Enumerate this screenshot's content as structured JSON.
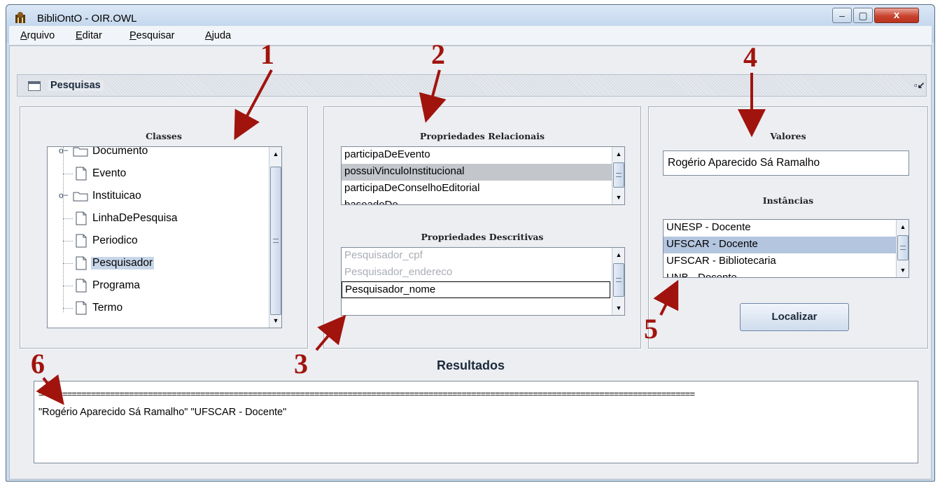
{
  "window": {
    "title": "BibliOntO - OIR.OWL",
    "controls": {
      "minimize": "‒",
      "maximize": "▢",
      "close": "x"
    }
  },
  "menu": [
    "Arquivo",
    "Editar",
    "Pesquisar",
    "Ajuda"
  ],
  "internal_frame": {
    "title": "Pesquisas"
  },
  "classes_panel": {
    "title": "Classes",
    "items": [
      "Documento",
      "Evento",
      "Instituicao",
      "LinhaDePesquisa",
      "Periodico",
      "Pesquisador",
      "Programa",
      "Termo"
    ],
    "selected": "Pesquisador"
  },
  "relational_panel": {
    "title": "Propriedades Relacionais",
    "items": [
      "participaDeEvento",
      "possuiVinculoInstitucional",
      "participaDeConselhoEditorial",
      "baseadoDe"
    ],
    "selected": "possuiVinculoInstitucional"
  },
  "descriptive_panel": {
    "title": "Propriedades Descritivas",
    "items": [
      "Pesquisador_cpf",
      "Pesquisador_endereco",
      "Pesquisador_nome",
      ""
    ],
    "selected": "Pesquisador_nome"
  },
  "values_panel": {
    "title": "Valores",
    "value": "Rogério Aparecido Sá Ramalho",
    "instances_title": "Instâncias",
    "instances": [
      "UNESP - Docente",
      "UFSCAR - Docente",
      "UFSCAR - Bibliotecaria",
      "UNB - Docente"
    ],
    "selected_instance": "UFSCAR - Docente",
    "locate_button": "Localizar"
  },
  "results": {
    "title": "Resultados",
    "separator": "==========================================================================================================================================",
    "line": "\"Rogério Aparecido Sá Ramalho\"  \"UFSCAR - Docente\""
  },
  "annotations": [
    "1",
    "2",
    "3",
    "4",
    "5",
    "6"
  ],
  "colors": {
    "annotation": "#a0140d",
    "selection": "#b4c6df",
    "window_frame": "#c9dcee"
  }
}
